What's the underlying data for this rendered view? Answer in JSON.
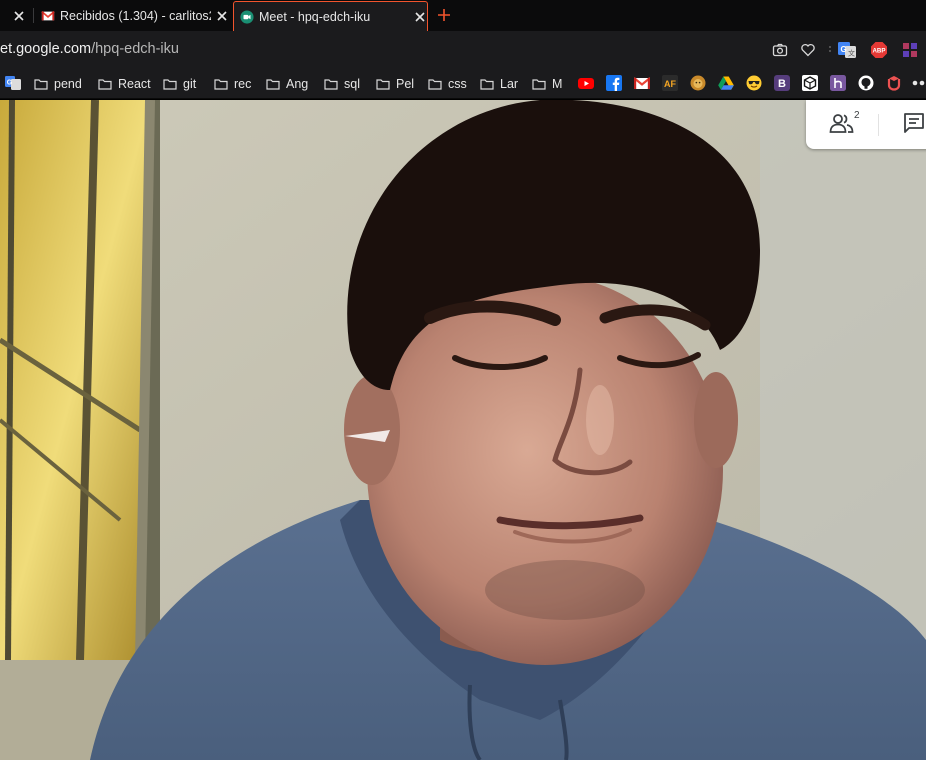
{
  "tabs": [
    {
      "title": "",
      "favicon": "gmail-icon",
      "active": false
    },
    {
      "title": "Recibidos (1.304) - carlitos2",
      "favicon": "gmail-icon",
      "active": false
    },
    {
      "title": "Meet - hpq-edch-iku",
      "favicon": "google-meet-icon",
      "active": true
    }
  ],
  "new_tab_icon": "plus-icon",
  "address_bar": {
    "host": "et.google.com",
    "path": "/hpq-edch-iku",
    "icons": [
      "camera-icon",
      "heart-icon",
      "google-translate-icon",
      "adblock-plus-icon",
      "extension-icon"
    ]
  },
  "bookmarks": {
    "leading_icon": "google-translate-icon",
    "folders": [
      "pend",
      "React",
      "git",
      "rec",
      "Ang",
      "sql",
      "Pel",
      "css",
      "Lar",
      "M"
    ],
    "icon_items": [
      "youtube-icon",
      "facebook-icon",
      "gmail-icon",
      "af-icon",
      "lion-icon",
      "google-drive-icon",
      "sunglasses-emoji-icon",
      "bootstrap-icon",
      "codesandbox-icon",
      "heroku-icon",
      "github-icon",
      "udemy-icon",
      "more-icon"
    ]
  },
  "meet": {
    "participants_icon": "people-icon",
    "participant_count": "2",
    "chat_icon": "chat-icon"
  },
  "colors": {
    "accent": "#f2542d",
    "tabbar_bg": "#0b0b0c",
    "toolbar_bg": "#1b1b1d",
    "meet_panel_bg": "#ffffff"
  }
}
